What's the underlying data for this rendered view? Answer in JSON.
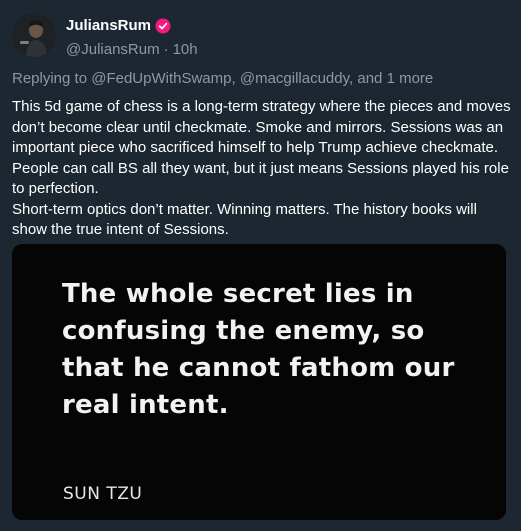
{
  "author": {
    "display_name": "JuliansRum",
    "handle": "@JuliansRum",
    "separator": "·",
    "time": "10h"
  },
  "reply": {
    "prefix": "Replying to",
    "user1": "@FedUpWithSwamp",
    "comma": ",",
    "user2": "@macgillacuddy",
    "suffix": ", and",
    "more": "1 more"
  },
  "tweet": {
    "paragraph1": "This 5d game of chess is a long-term strategy where the pieces and moves don’t become clear until checkmate. Smoke and mirrors. Sessions was an important piece who sacrificed himself to help Trump achieve checkmate. People can call BS all they want, but it just means Sessions played his role to perfection.",
    "paragraph2": "Short-term optics don’t matter. Winning matters. The history books will show the true intent of Sessions."
  },
  "media": {
    "quote": "The whole secret lies in confusing the enemy, so that he cannot fathom our real intent.",
    "attribution": "SUN TZU"
  },
  "colors": {
    "background": "#1c2732",
    "secondary_text": "#8b98a5",
    "verified_badge": "#f91880",
    "media_background": "#050505"
  },
  "icons": {
    "verified": "verified-badge-icon"
  }
}
